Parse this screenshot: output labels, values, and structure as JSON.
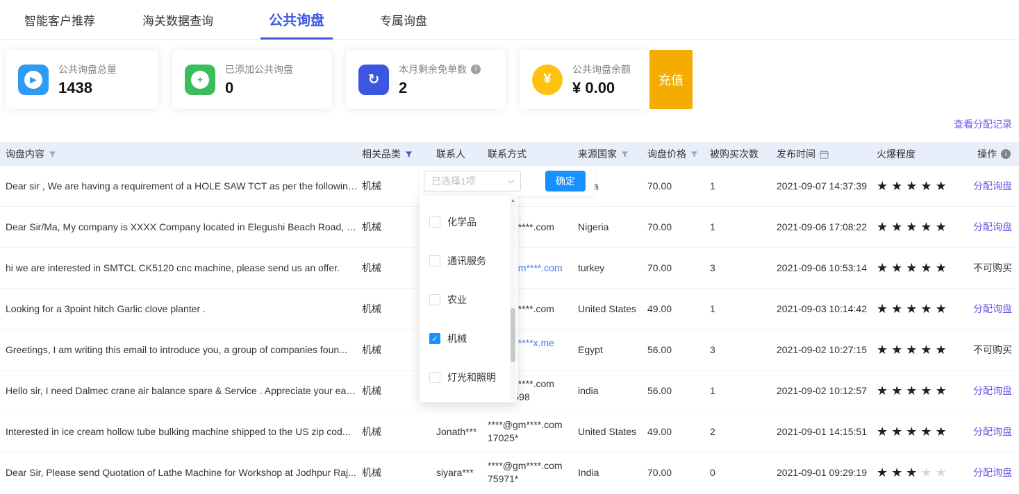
{
  "colors": {
    "accent_blue": "#3d56e0",
    "link_purple": "#6a5ae6",
    "link_blue": "#477be0",
    "header_bg": "#e9eefb",
    "confirm_blue": "#1890ff",
    "star_filled": "#1f1f1f",
    "star_empty": "#d8d8d8",
    "recharge_yellow": "#f5ac00"
  },
  "tabs": [
    {
      "name": "smart-customer-recommendation",
      "label": "智能客户推荐",
      "active": false
    },
    {
      "name": "customs-data-query",
      "label": "海关数据查询",
      "active": false
    },
    {
      "name": "public-inquiry",
      "label": "公共询盘",
      "active": true
    },
    {
      "name": "exclusive-inquiry",
      "label": "专属询盘",
      "active": false
    }
  ],
  "stats": [
    {
      "name": "total-public-inquiries",
      "icon": "send-icon",
      "color": "#2e9cf5",
      "shape": "square",
      "style": "disc",
      "label": "公共询盘总量",
      "value": "1438",
      "info": false
    },
    {
      "name": "added-public-inquiries",
      "icon": "plus-icon",
      "color": "#3cbd5c",
      "shape": "square",
      "style": "disc",
      "label": "已添加公共询盘",
      "value": "0",
      "info": false
    },
    {
      "name": "remaining-free-orders",
      "icon": "refresh-icon",
      "color": "#3d56e0",
      "shape": "square",
      "style": "plain",
      "label": "本月剩余免单数",
      "value": "2",
      "info": true
    },
    {
      "name": "public-inquiry-balance",
      "icon": "yuan-icon",
      "color": "#ffc211",
      "shape": "circle",
      "style": "plain",
      "label": "公共询盘余额",
      "value": "¥ 0.00",
      "info": false
    }
  ],
  "recharge_button": "充值",
  "records_link": "查看分配记录",
  "filter_dropdown": {
    "selected_text": "已选择1项",
    "confirm_button": "确定",
    "options": [
      {
        "label": "化学品",
        "checked": false
      },
      {
        "label": "通讯服务",
        "checked": false
      },
      {
        "label": "农业",
        "checked": false
      },
      {
        "label": "机械",
        "checked": true
      },
      {
        "label": "灯光和照明",
        "checked": false
      }
    ]
  },
  "table": {
    "headers": [
      {
        "key": "content",
        "label": "询盘内容",
        "icon": "filter"
      },
      {
        "key": "category",
        "label": "相关品类",
        "icon": "filter-active"
      },
      {
        "key": "contact",
        "label": "联系人"
      },
      {
        "key": "method",
        "label": "联系方式"
      },
      {
        "key": "country",
        "label": "来源国家",
        "icon": "filter"
      },
      {
        "key": "price",
        "label": "询盘价格",
        "icon": "filter"
      },
      {
        "key": "count",
        "label": "被购买次数"
      },
      {
        "key": "time",
        "label": "发布时间",
        "icon": "calendar"
      },
      {
        "key": "stars",
        "label": "火爆程度"
      },
      {
        "key": "action",
        "label": "操作",
        "icon": "info"
      }
    ],
    "rows": [
      {
        "content": "Dear sir , We are having a requirement of a HOLE SAW TCT as per the following...",
        "category": "机械",
        "contact": "",
        "email": "",
        "email_link": false,
        "phone": "",
        "country": "india",
        "price": "70.00",
        "count": "1",
        "time": "2021-09-07 14:37:39",
        "stars": 5,
        "action": "分配询盘",
        "action_type": "link"
      },
      {
        "content": "Dear Sir/Ma, My company is XXXX Company located in Elegushi Beach Road, L...",
        "category": "机械",
        "contact": "",
        "email": "****@e****.com",
        "email_link": false,
        "phone": "",
        "country": "Nigeria",
        "price": "70.00",
        "count": "1",
        "time": "2021-09-06 17:08:22",
        "stars": 5,
        "action": "分配询盘",
        "action_type": "link"
      },
      {
        "content": "hi we are interested in SMTCL CK5120 cnc machine, please send us an offer.",
        "category": "机械",
        "contact": "",
        "email": "****@gm****.com",
        "email_link": true,
        "phone": "",
        "country": "turkey",
        "price": "70.00",
        "count": "3",
        "time": "2021-09-06 10:53:14",
        "stars": 5,
        "action": "不可购买",
        "action_type": "text"
      },
      {
        "content": "Looking for a 3point hitch Garlic clove planter .",
        "category": "机械",
        "contact": "",
        "email": "****@u****.com",
        "email_link": false,
        "phone": "",
        "country": "United States",
        "price": "49.00",
        "count": "1",
        "time": "2021-09-03 10:14:42",
        "stars": 5,
        "action": "分配询盘",
        "action_type": "link"
      },
      {
        "content": "Greetings, I am writing this email to introduce you, a group of companies foun...",
        "category": "机械",
        "contact": "",
        "email": "****@p****x.me",
        "email_link": true,
        "phone": "********",
        "country": "Egypt",
        "price": "56.00",
        "count": "3",
        "time": "2021-09-02 10:27:15",
        "stars": 5,
        "action": "不可购买",
        "action_type": "text"
      },
      {
        "content": "Hello sir, I need Dalmec crane air balance spare & Service . Appreciate your earl...",
        "category": "机械",
        "contact": "",
        "email": "****@a****.com",
        "email_link": false,
        "phone": "****89598",
        "country": "india",
        "price": "56.00",
        "count": "1",
        "time": "2021-09-02 10:12:57",
        "stars": 5,
        "action": "分配询盘",
        "action_type": "link"
      },
      {
        "content": "Interested in ice cream hollow tube bulking machine shipped to the US zip cod...",
        "category": "机械",
        "contact": "Jonath***",
        "email": "****@gm****.com",
        "email_link": false,
        "phone": "17025*",
        "country": "United States",
        "price": "49.00",
        "count": "2",
        "time": "2021-09-01 14:15:51",
        "stars": 5,
        "action": "分配询盘",
        "action_type": "link"
      },
      {
        "content": "Dear Sir, Please send Quotation of Lathe Machine for Workshop at Jodhpur Raj...",
        "category": "机械",
        "contact": "siyara***",
        "email": "****@gm****.com",
        "email_link": false,
        "phone": "75971*",
        "country": "India",
        "price": "70.00",
        "count": "0",
        "time": "2021-09-01 09:29:19",
        "stars": 3,
        "action": "分配询盘",
        "action_type": "link"
      }
    ]
  }
}
